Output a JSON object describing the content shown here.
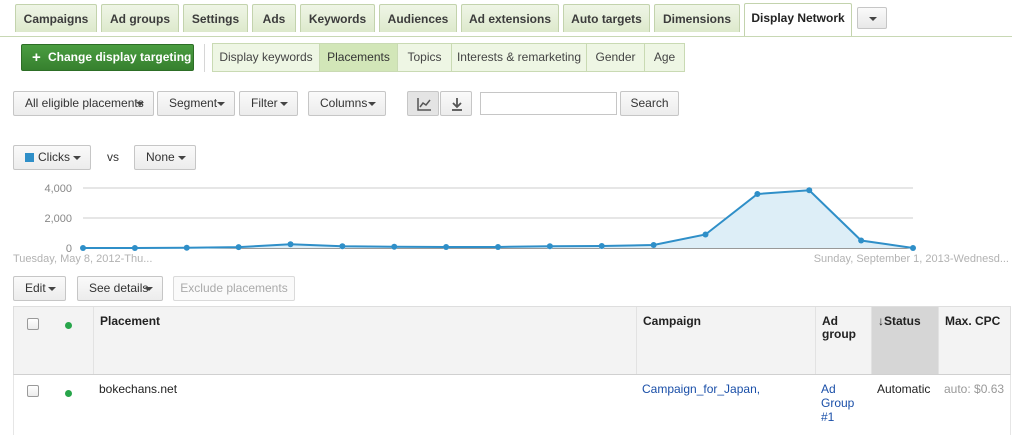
{
  "top_tabs": [
    "Campaigns",
    "Ad groups",
    "Settings",
    "Ads",
    "Keywords",
    "Audiences",
    "Ad extensions",
    "Auto targets",
    "Dimensions",
    "Display Network"
  ],
  "change_targeting_label": "Change display targeting",
  "sub_tabs": [
    "Display keywords",
    "Placements",
    "Topics",
    "Interests & remarketing",
    "Gender",
    "Age"
  ],
  "toolbar": {
    "placements_filter": "All eligible placements",
    "segment": "Segment",
    "filter": "Filter",
    "columns": "Columns",
    "search_value": "",
    "search_button": "Search"
  },
  "chart_controls": {
    "metric1": "Clicks",
    "vs": "vs",
    "metric2": "None"
  },
  "chart_data": {
    "type": "area",
    "series": [
      {
        "name": "Clicks",
        "values": [
          0,
          0,
          20,
          60,
          250,
          120,
          80,
          70,
          70,
          120,
          130,
          200,
          900,
          3600,
          3850,
          500,
          0
        ]
      }
    ],
    "y_ticks": [
      "4,000",
      "2,000",
      "0"
    ],
    "ylim": [
      0,
      4000
    ],
    "x_start_label": "Tuesday, May 8, 2012-Thu...",
    "x_end_label": "Sunday, September 1, 2013-Wednesd...",
    "colors": {
      "line": "#2f8fc8",
      "fill": "#ddeef7"
    },
    "grid": true
  },
  "table_toolbar": {
    "edit": "Edit",
    "see_details": "See details",
    "exclude": "Exclude placements"
  },
  "table": {
    "headers": {
      "placement": "Placement",
      "campaign": "Campaign",
      "ad_group": "Ad group",
      "status": "Status",
      "max_cpc": "Max. CPC"
    },
    "sort_indicator": "↓",
    "rows": [
      {
        "placement": "bokechans.net",
        "campaign": "Campaign_for_Japan,",
        "ad_group": "Ad Group #1",
        "status": "Automatic",
        "max_cpc": "auto: $0.63"
      }
    ]
  }
}
